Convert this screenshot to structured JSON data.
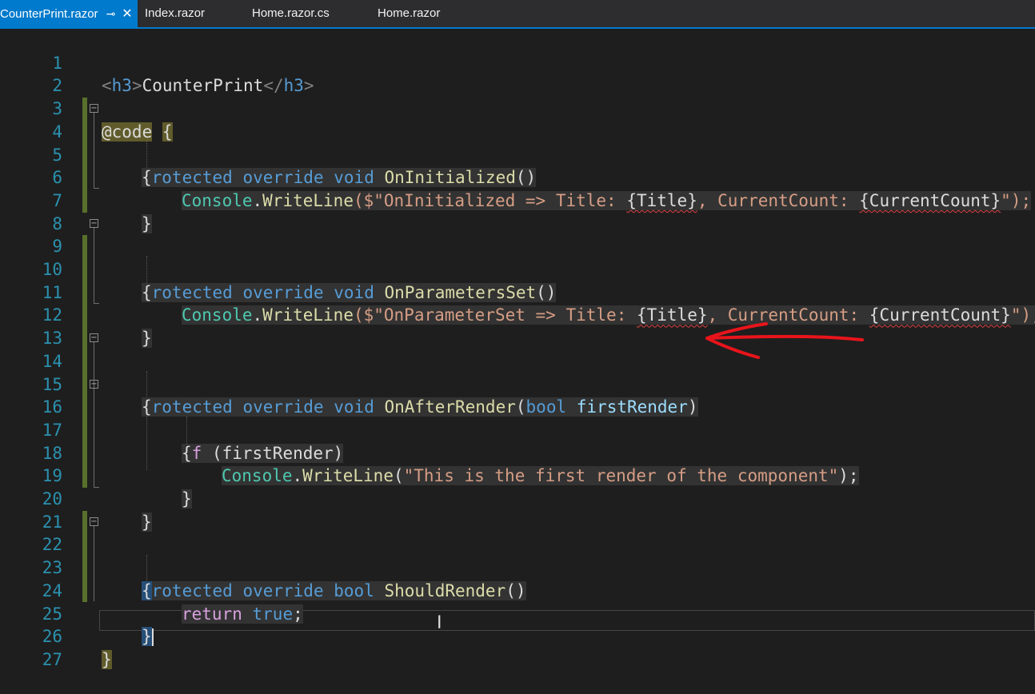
{
  "tabs": [
    {
      "label": "CounterPrint.razor",
      "active": true,
      "pin_icon": "pin-icon",
      "close_icon": "close-icon",
      "pin_glyph": "⊸",
      "close_glyph": "✕"
    },
    {
      "label": "Index.razor",
      "active": false
    },
    {
      "label": "Home.razor.cs",
      "active": false
    },
    {
      "label": "Home.razor",
      "active": false
    }
  ],
  "editor": {
    "line_numbers": [
      "1",
      "2",
      "3",
      "4",
      "5",
      "6",
      "7",
      "8",
      "9",
      "10",
      "11",
      "12",
      "13",
      "14",
      "15",
      "16",
      "17",
      "18",
      "19",
      "20",
      "21",
      "22",
      "23",
      "24",
      "25",
      "26",
      "27"
    ],
    "code": {
      "l1_open": "<",
      "l1_tag": "h3",
      "l1_close": ">",
      "l1_text": "CounterPrint",
      "l1_end_open": "</",
      "l1_end_tag": "h3",
      "l1_end_close": ">",
      "l3_razor": "@code",
      "l3_brace": "{",
      "protected": "protected",
      "override": "override",
      "void": "void",
      "bool": "bool",
      "l4_method": "OnInitialized",
      "parens": "()",
      "open_brace": "{",
      "close_brace": "}",
      "console": "Console",
      "dot": ".",
      "writeline": "WriteLine",
      "l6_args_a": "($\"OnInitialized => Title: ",
      "l6_title": "{Title}",
      "l6_args_b": ", CurrentCount: ",
      "l6_count": "{CurrentCount}",
      "l6_end": "\");",
      "l9_method": "OnParametersSet",
      "l11_args_a": "($\"OnParameterSet => Title: ",
      "l14_method": "OnAfterRender",
      "l14_open": "(",
      "l14_param": "firstRender",
      "l14_close": ")",
      "if": "if",
      "l16_cond": "(firstRender)",
      "l18_string": "\"This is the first render of the component\"",
      "l18_end": ");",
      "open_paren": "(",
      "l22_method": "ShouldRender",
      "return": "return",
      "true": "true",
      "semicolon": ";"
    }
  },
  "annotation": {
    "description": "red arrow",
    "color": "#e8141b"
  },
  "colors": {
    "accent": "#007acc",
    "background": "#1e1e1e",
    "line_number": "#2b91af"
  }
}
